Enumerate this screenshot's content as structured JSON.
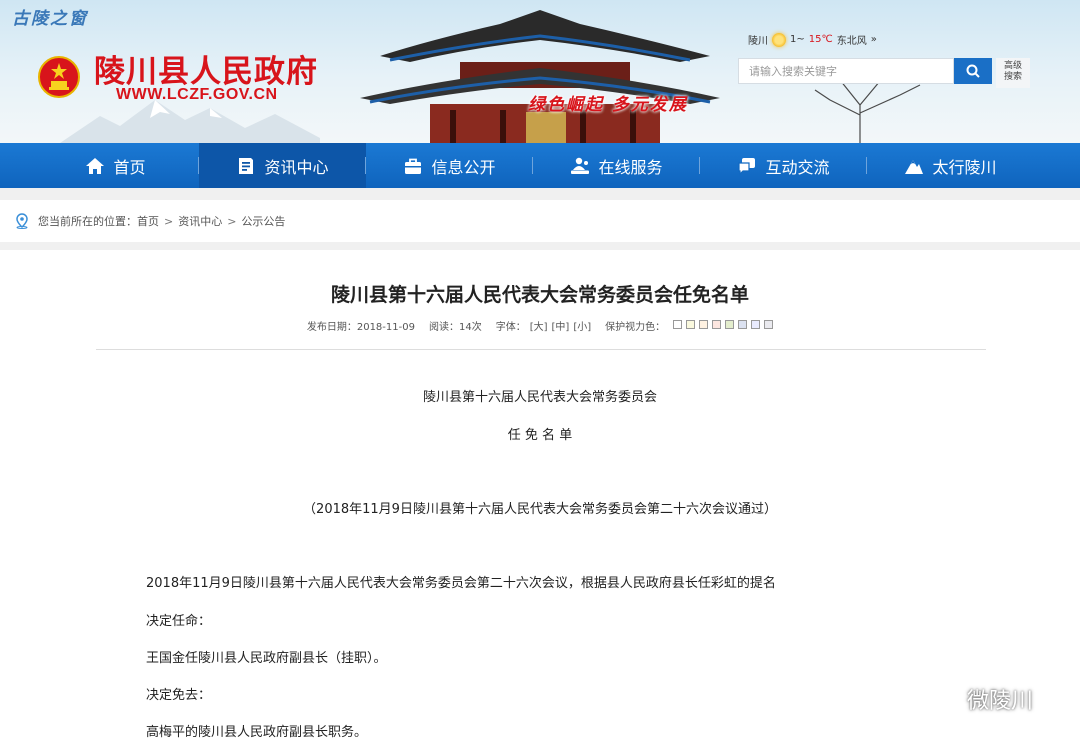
{
  "header": {
    "tag_top": "古陵之窗",
    "site_title": "陵川县人民政府",
    "site_url": "WWW.LCZF.GOV.CN",
    "slogan": "绿色崛起  多元发展",
    "weather": {
      "city": "陵川",
      "temp_low": "1~",
      "temp_high": "15℃",
      "wind": "东北风",
      "more": "»"
    },
    "search": {
      "placeholder": "请输入搜索关键字",
      "advanced_line1": "高级",
      "advanced_line2": "搜索"
    }
  },
  "nav": {
    "items": [
      {
        "label": "首页",
        "icon": "home-icon"
      },
      {
        "label": "资讯中心",
        "icon": "document-icon"
      },
      {
        "label": "信息公开",
        "icon": "briefcase-icon"
      },
      {
        "label": "在线服务",
        "icon": "service-desk-icon"
      },
      {
        "label": "互动交流",
        "icon": "chat-icon"
      },
      {
        "label": "太行陵川",
        "icon": "mountain-icon"
      }
    ]
  },
  "breadcrumb": {
    "prefix": "您当前所在的位置：",
    "items": [
      "首页",
      "资讯中心",
      "公示公告"
    ],
    "separator": ">"
  },
  "article": {
    "title": "陵川县第十六届人民代表大会常务委员会任免名单",
    "meta": {
      "date_label": "发布日期：2018-11-09",
      "views_label": "阅读：14次",
      "font_label": "字体：",
      "font_large": "[大]",
      "font_medium": "[中]",
      "font_small": "[小]",
      "eye_label": "保护视力色："
    },
    "swatch_colors": [
      "#ffffff",
      "#faf9de",
      "#fff2e2",
      "#fde6e0",
      "#e3edcd",
      "#dce2f1",
      "#e9ebfe",
      "#eaeaef"
    ],
    "org_line": "陵川县第十六届人民代表大会常务委员会",
    "list_title": "任 免 名 单",
    "passed_note": "（2018年11月9日陵川县第十六届人民代表大会常务委员会第二十六次会议通过）",
    "paragraphs": [
      "2018年11月9日陵川县第十六届人民代表大会常务委员会第二十六次会议，根据县人民政府县长任彩虹的提名",
      "决定任命：",
      "王国金任陵川县人民政府副县长（挂职）。",
      "决定免去：",
      "高梅平的陵川县人民政府副县长职务。"
    ]
  },
  "watermark": {
    "text": "微陵川"
  }
}
